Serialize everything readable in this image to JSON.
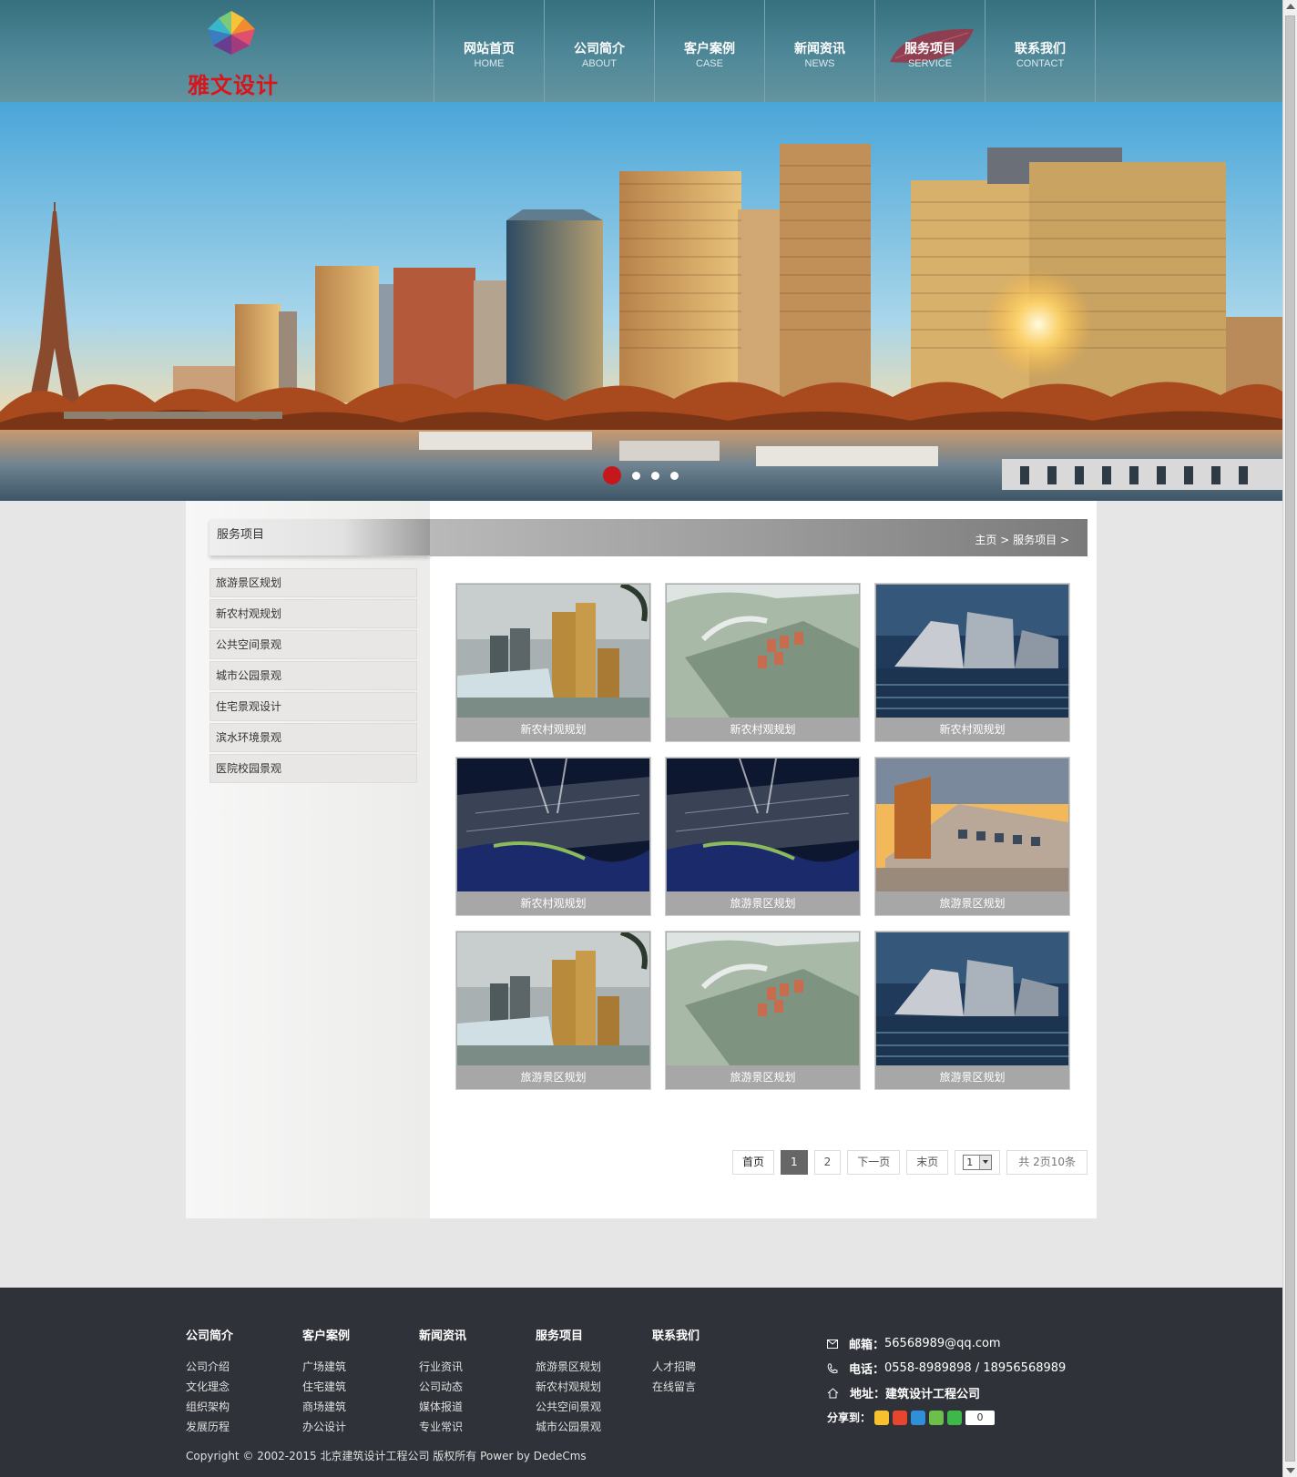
{
  "brand": {
    "name": "雅文设计"
  },
  "nav": [
    {
      "cn": "网站首页",
      "en": "HOME"
    },
    {
      "cn": "公司简介",
      "en": "ABOUT"
    },
    {
      "cn": "客户案例",
      "en": "CASE"
    },
    {
      "cn": "新闻资讯",
      "en": "NEWS"
    },
    {
      "cn": "服务项目",
      "en": "SERVICE",
      "active": true
    },
    {
      "cn": "联系我们",
      "en": "CONTACT"
    }
  ],
  "banner": {
    "slides": 4,
    "active_index": 0
  },
  "sidebar": {
    "title": "服务项目",
    "items": [
      "旅游景区规划",
      "新农村观规划",
      "公共空间景观",
      "城市公园景观",
      "住宅景观设计",
      "滨水环境景观",
      "医院校园景观"
    ]
  },
  "breadcrumb": {
    "home": "主页",
    "sep": ">",
    "current": "服务项目"
  },
  "products": [
    {
      "caption": "新农村观规划",
      "image": "highrise-towers"
    },
    {
      "caption": "新农村观规划",
      "image": "aerial-village"
    },
    {
      "caption": "新农村观规划",
      "image": "waterfront-museum"
    },
    {
      "caption": "新农村观规划",
      "image": "night-city-aerial"
    },
    {
      "caption": "旅游景区规划",
      "image": "night-city-aerial"
    },
    {
      "caption": "旅游景区规划",
      "image": "campus-sunset"
    },
    {
      "caption": "旅游景区规划",
      "image": "highrise-towers"
    },
    {
      "caption": "旅游景区规划",
      "image": "aerial-village"
    },
    {
      "caption": "旅游景区规划",
      "image": "waterfront-museum"
    }
  ],
  "pager": {
    "first": "首页",
    "pages": [
      "1",
      "2"
    ],
    "current": "1",
    "next": "下一页",
    "last": "末页",
    "select_value": "1",
    "info": "共 2页10条"
  },
  "footer": {
    "columns": [
      {
        "title": "公司简介",
        "links": [
          "公司介绍",
          "文化理念",
          "组织架构",
          "发展历程"
        ]
      },
      {
        "title": "客户案例",
        "links": [
          "广场建筑",
          "住宅建筑",
          "商场建筑",
          "办公设计"
        ]
      },
      {
        "title": "新闻资讯",
        "links": [
          "行业资讯",
          "公司动态",
          "媒体报道",
          "专业常识"
        ]
      },
      {
        "title": "服务项目",
        "links": [
          "旅游景区规划",
          "新农村观规划",
          "公共空间景观",
          "城市公园景观"
        ]
      },
      {
        "title": "联系我们",
        "links": [
          "人才招聘",
          "在线留言"
        ]
      }
    ],
    "contact": {
      "email_label": "邮箱：",
      "email": "56568989@qq.com",
      "phone_label": "电话：",
      "phone": "0558-8989898 / 18956568989",
      "address_label": "地址：",
      "address": "建筑设计工程公司"
    },
    "share": {
      "label": "分享到：",
      "count": "0",
      "icons": [
        "qzone-icon",
        "weibo-icon",
        "tencent-icon",
        "wechat-icon",
        "more-icon"
      ]
    },
    "copyright": "Copyright © 2002-2015 北京建筑设计工程公司 版权所有 Power by DedeCms"
  },
  "colors": {
    "header": "#4a8393",
    "accent": "#c4181c",
    "footer": "#2f3239",
    "caption": "#a7a7a7"
  }
}
